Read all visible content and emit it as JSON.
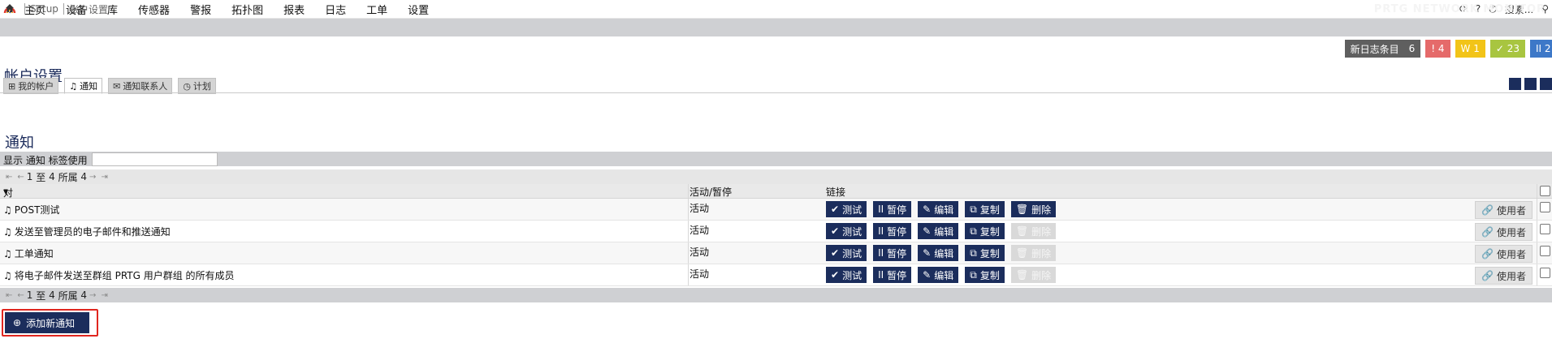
{
  "nav": {
    "menu": [
      "主页",
      "设备",
      "库",
      "传感器",
      "警报",
      "拓扑图",
      "报表",
      "日志",
      "工单",
      "设置"
    ],
    "search_placeholder": "搜索...",
    "help": "?"
  },
  "breadcrumb": {
    "items": [
      "Setup",
      "帐户设置"
    ],
    "brand": "PRTG NETWORK MONITOR"
  },
  "status": {
    "log_label": "新日志条目",
    "log_count": "6",
    "red": "! 4",
    "yellow": "W 1",
    "green": "✓ 23",
    "blue": "II 2"
  },
  "page": {
    "title": "帐户设置",
    "section_title": "通知"
  },
  "tabs": [
    {
      "label": "我的帐户",
      "icon": "account-icon"
    },
    {
      "label": "通知",
      "icon": "bell-icon"
    },
    {
      "label": "通知联系人",
      "icon": "mail-icon"
    },
    {
      "label": "计划",
      "icon": "clock-icon"
    }
  ],
  "filter": {
    "label": "显示 通知 标签使用"
  },
  "pager": {
    "first": "1",
    "sep": "至",
    "last": "4",
    "word": "所属",
    "total": "4"
  },
  "table": {
    "headers": {
      "object": "对象",
      "status": "活动/暂停",
      "links": "链接"
    },
    "buttons": {
      "test": "测试",
      "pause": "暂停",
      "edit": "编辑",
      "copy": "复制",
      "delete": "删除",
      "used_by": "使用者"
    },
    "rows": [
      {
        "name": "POST测试",
        "status": "活动",
        "delete_enabled": true
      },
      {
        "name": "发送至管理员的电子邮件和推送通知",
        "status": "活动",
        "delete_enabled": false
      },
      {
        "name": "工单通知",
        "status": "活动",
        "delete_enabled": false
      },
      {
        "name": "将电子邮件发送至群组 PRTG 用户群组 的所有成员",
        "status": "活动",
        "delete_enabled": false
      }
    ]
  },
  "add_button": {
    "label": "添加新通知"
  },
  "colors": {
    "navy": "#1b2d5c",
    "highlight": "#e0261f"
  }
}
